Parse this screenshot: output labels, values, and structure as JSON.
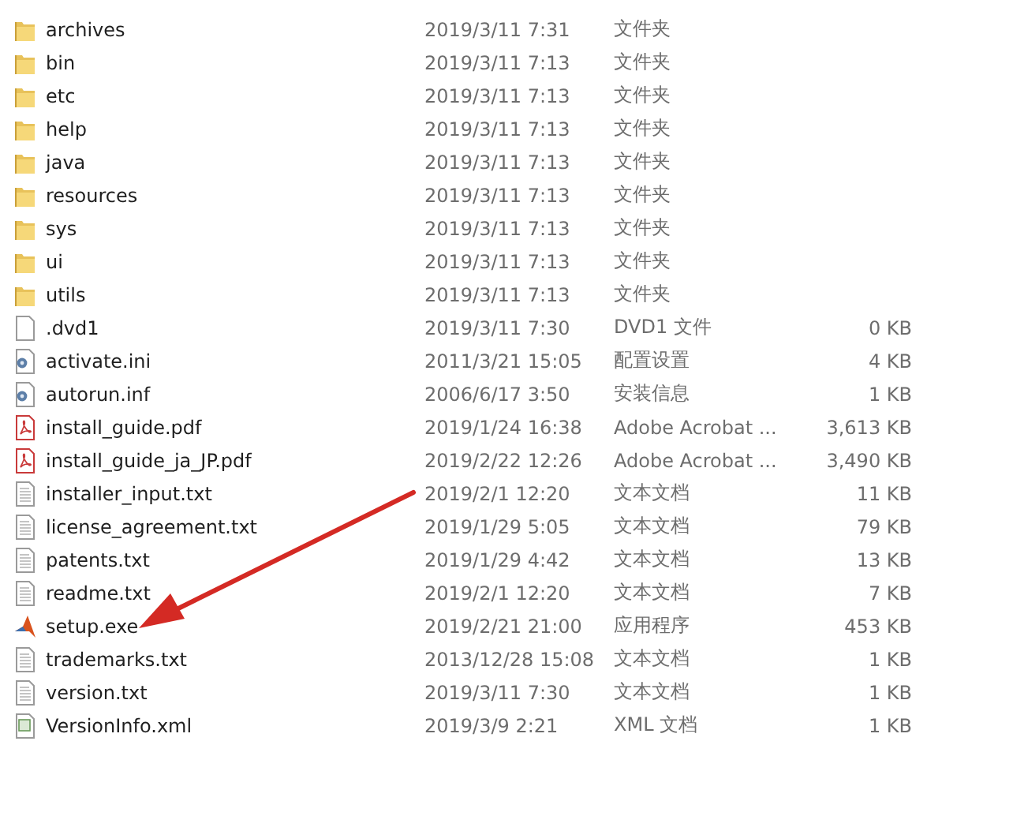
{
  "files": [
    {
      "kind": "folder",
      "name": "archives",
      "modified": "2019/3/11 7:31",
      "type": "文件夹"
    },
    {
      "kind": "folder",
      "name": "bin",
      "modified": "2019/3/11 7:13",
      "type": "文件夹"
    },
    {
      "kind": "folder",
      "name": "etc",
      "modified": "2019/3/11 7:13",
      "type": "文件夹"
    },
    {
      "kind": "folder",
      "name": "help",
      "modified": "2019/3/11 7:13",
      "type": "文件夹"
    },
    {
      "kind": "folder",
      "name": "java",
      "modified": "2019/3/11 7:13",
      "type": "文件夹"
    },
    {
      "kind": "folder",
      "name": "resources",
      "modified": "2019/3/11 7:13",
      "type": "文件夹"
    },
    {
      "kind": "folder",
      "name": "sys",
      "modified": "2019/3/11 7:13",
      "type": "文件夹"
    },
    {
      "kind": "folder",
      "name": "ui",
      "modified": "2019/3/11 7:13",
      "type": "文件夹"
    },
    {
      "kind": "folder",
      "name": "utils",
      "modified": "2019/3/11 7:13",
      "type": "文件夹"
    },
    {
      "kind": "blank",
      "name": ".dvd1",
      "modified": "2019/3/11 7:30",
      "type": "DVD1 文件",
      "size": "0 KB"
    },
    {
      "kind": "config",
      "name": "activate.ini",
      "modified": "2011/3/21 15:05",
      "type": "配置设置",
      "size": "4 KB"
    },
    {
      "kind": "config",
      "name": "autorun.inf",
      "modified": "2006/6/17 3:50",
      "type": "安装信息",
      "size": "1 KB"
    },
    {
      "kind": "pdf",
      "name": "install_guide.pdf",
      "modified": "2019/1/24 16:38",
      "type": "Adobe Acrobat ...",
      "size": "3,613 KB"
    },
    {
      "kind": "pdf",
      "name": "install_guide_ja_JP.pdf",
      "modified": "2019/2/22 12:26",
      "type": "Adobe Acrobat ...",
      "size": "3,490 KB"
    },
    {
      "kind": "text",
      "name": "installer_input.txt",
      "modified": "2019/2/1 12:20",
      "type": "文本文档",
      "size": "11 KB"
    },
    {
      "kind": "text",
      "name": "license_agreement.txt",
      "modified": "2019/1/29 5:05",
      "type": "文本文档",
      "size": "79 KB"
    },
    {
      "kind": "text",
      "name": "patents.txt",
      "modified": "2019/1/29 4:42",
      "type": "文本文档",
      "size": "13 KB"
    },
    {
      "kind": "text",
      "name": "readme.txt",
      "modified": "2019/2/1 12:20",
      "type": "文本文档",
      "size": "7 KB"
    },
    {
      "kind": "app",
      "name": "setup.exe",
      "modified": "2019/2/21 21:00",
      "type": "应用程序",
      "size": "453 KB"
    },
    {
      "kind": "text",
      "name": "trademarks.txt",
      "modified": "2013/12/28 15:08",
      "type": "文本文档",
      "size": "1 KB"
    },
    {
      "kind": "text",
      "name": "version.txt",
      "modified": "2019/3/11 7:30",
      "type": "文本文档",
      "size": "1 KB"
    },
    {
      "kind": "xml",
      "name": "VersionInfo.xml",
      "modified": "2019/3/9 2:21",
      "type": "XML 文档",
      "size": "1 KB"
    }
  ]
}
